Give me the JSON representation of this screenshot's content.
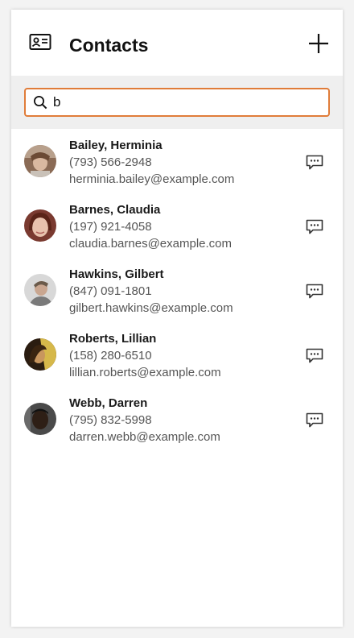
{
  "header": {
    "title": "Contacts",
    "app_icon": "contact-card-icon",
    "add_icon": "plus-icon"
  },
  "search": {
    "value": "b",
    "icon": "search-icon",
    "border_color": "#e07c39"
  },
  "contacts": [
    {
      "name": "Bailey, Herminia",
      "phone": "(793) 566-2948",
      "email": "herminia.bailey@example.com",
      "action_icon": "message-icon"
    },
    {
      "name": "Barnes, Claudia",
      "phone": "(197) 921-4058",
      "email": "claudia.barnes@example.com",
      "action_icon": "message-icon"
    },
    {
      "name": "Hawkins, Gilbert",
      "phone": "(847) 091-1801",
      "email": "gilbert.hawkins@example.com",
      "action_icon": "message-icon"
    },
    {
      "name": "Roberts, Lillian",
      "phone": "(158) 280-6510",
      "email": "lillian.roberts@example.com",
      "action_icon": "message-icon"
    },
    {
      "name": "Webb, Darren",
      "phone": "(795) 832-5998",
      "email": "darren.webb@example.com",
      "action_icon": "message-icon"
    }
  ]
}
